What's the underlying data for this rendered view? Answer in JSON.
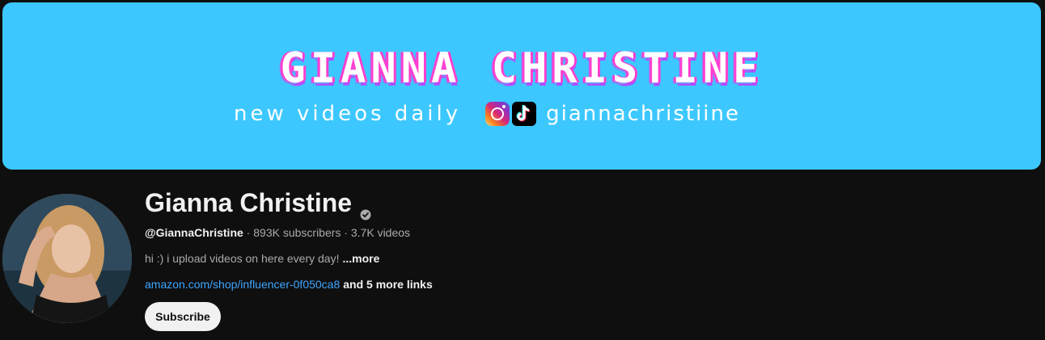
{
  "banner": {
    "title": "GIANNA CHRISTINE",
    "tagline": "new videos daily",
    "handle": "giannachristiine",
    "background_color": "#3cc8fe",
    "icons": [
      "instagram-icon",
      "tiktok-icon"
    ]
  },
  "channel": {
    "name": "Gianna Christine",
    "verified": true,
    "handle": "@GiannaChristine",
    "subscribers": "893K subscribers",
    "videos": "3.7K videos",
    "separator": " · ",
    "description": "hi :) i upload videos on here every day!",
    "more_label": "...more",
    "link": "amazon.com/shop/influencer-0f050ca8",
    "more_links": "and 5 more links",
    "link_color": "#3ea6ff"
  },
  "actions": {
    "subscribe_label": "Subscribe"
  }
}
